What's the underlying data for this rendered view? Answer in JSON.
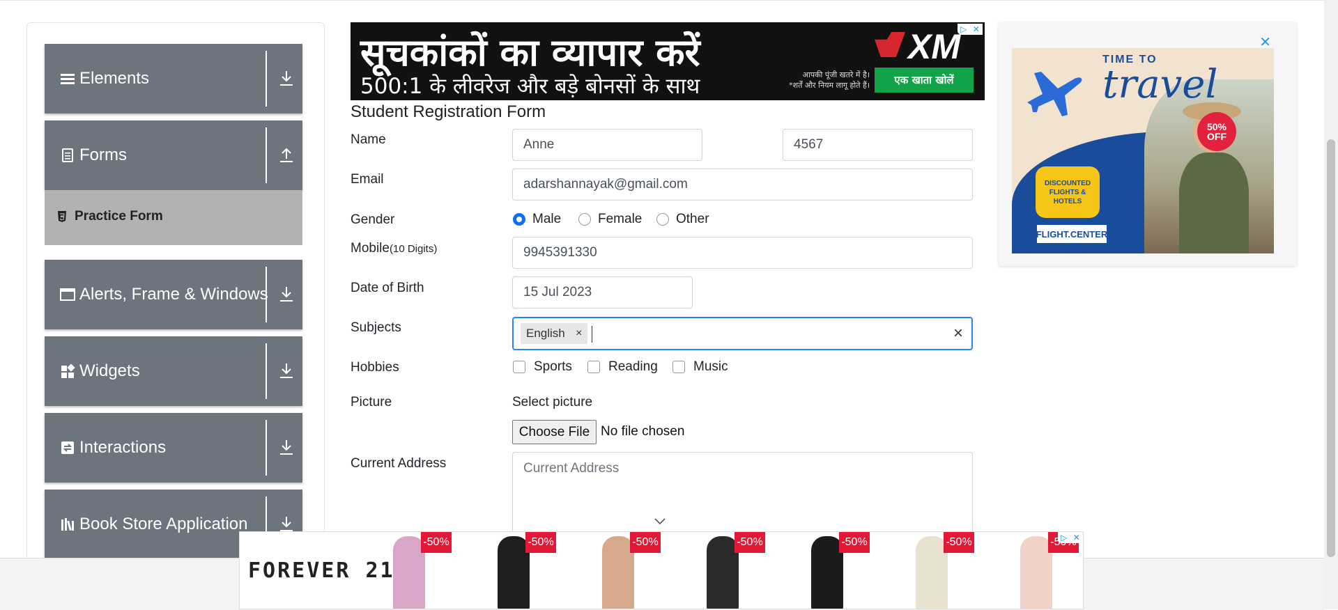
{
  "sidebar": {
    "groups": [
      {
        "label": "Elements",
        "icon": "hamburger-icon",
        "arrow": "download-arrow-icon"
      },
      {
        "label": "Forms",
        "icon": "document-icon",
        "arrow": "upload-arrow-icon"
      },
      {
        "label": "Alerts, Frame & Windows",
        "icon": "window-icon",
        "arrow": "download-arrow-icon"
      },
      {
        "label": "Widgets",
        "icon": "widgets-icon",
        "arrow": "download-arrow-icon"
      },
      {
        "label": "Interactions",
        "icon": "interactions-icon",
        "arrow": "download-arrow-icon"
      },
      {
        "label": "Book Store Application",
        "icon": "books-icon",
        "arrow": "download-arrow-icon"
      }
    ],
    "active_item": {
      "label": "Practice Form",
      "icon": "html5-icon"
    }
  },
  "ads": {
    "top": {
      "headline": "सूचकांकों का व्यापार करें",
      "subline": "500:1 के लीवरेज और बड़े बोनसों के साथ",
      "brand": "XM",
      "note_line1": "आपकी पूंजी खतरे में है।",
      "note_line2": "*शर्तें और नियम लागू होते हैं।",
      "cta": "एक खाता खोलें"
    },
    "right": {
      "close": "✕",
      "kicker": "TIME TO",
      "title": "travel",
      "badge_line1": "50%",
      "badge_line2": "OFF",
      "bubble_line1": "DISCOUNTED",
      "bubble_line2": "FLIGHTS & HOTELS",
      "brand": "FLIGHT.CENTER"
    },
    "bottom": {
      "brand": "FOREVER 21",
      "discount": "-50%",
      "product_colors": [
        "#d9a6c8",
        "#1e1e1e",
        "#d6a98c",
        "#2a2a2a",
        "#1b1b1b",
        "#e9e2d0",
        "#f1d2c8"
      ]
    }
  },
  "form": {
    "title": "Student Registration Form",
    "name_label": "Name",
    "first_name": "Anne",
    "last_name": "4567",
    "email_label": "Email",
    "email": "adarshannayak@gmail.com",
    "gender_label": "Gender",
    "genders": [
      "Male",
      "Female",
      "Other"
    ],
    "gender_selected": "Male",
    "mobile_label": "Mobile",
    "mobile_hint": "(10 Digits)",
    "mobile": "9945391330",
    "dob_label": "Date of Birth",
    "dob": "15 Jul 2023",
    "subjects_label": "Subjects",
    "subject_chips": [
      "English"
    ],
    "chip_remove": "×",
    "subjects_clear": "×",
    "hobbies_label": "Hobbies",
    "hobbies": [
      "Sports",
      "Reading",
      "Music"
    ],
    "picture_label": "Picture",
    "select_picture": "Select picture",
    "choose_file": "Choose File",
    "no_file": "No file chosen",
    "address_label": "Current Address",
    "address_placeholder": "Current Address"
  },
  "colors": {
    "sidebar_group": "#6c757d",
    "active_item": "#b2b2b2",
    "focus": "#2684ff",
    "radio_on": "#0d6efd",
    "sale_tag": "#e31837"
  }
}
